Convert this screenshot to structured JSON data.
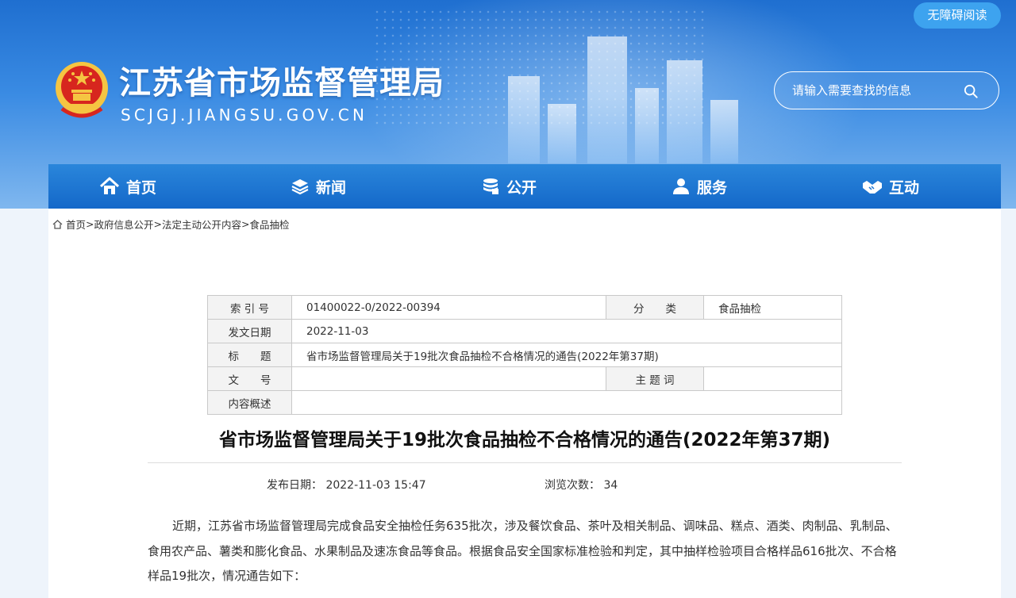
{
  "header": {
    "accessibility_label": "无障碍阅读",
    "site_title": "江苏省市场监督管理局",
    "site_domain": "SCJGJ.JIANGSU.GOV.CN",
    "search_placeholder": "请输入需要查找的信息"
  },
  "nav": {
    "items": [
      {
        "label": "首页",
        "icon": "home-icon"
      },
      {
        "label": "新闻",
        "icon": "layers-icon"
      },
      {
        "label": "公开",
        "icon": "database-icon"
      },
      {
        "label": "服务",
        "icon": "user-icon"
      },
      {
        "label": "互动",
        "icon": "handshake-icon"
      }
    ]
  },
  "breadcrumb": {
    "items": [
      "首页",
      "政府信息公开",
      "法定主动公开内容",
      "食品抽检"
    ],
    "separator": ">"
  },
  "meta_table": {
    "index_label": "索 引 号",
    "index_value": "01400022-0/2022-00394",
    "category_label": "分　　类",
    "category_value": "食品抽检",
    "date_label": "发文日期",
    "date_value": "2022-11-03",
    "title_label": "标　　题",
    "title_value": "省市场监督管理局关于19批次食品抽检不合格情况的通告(2022年第37期)",
    "docno_label": "文　　号",
    "docno_value": "",
    "keywords_label": "主 题 词",
    "keywords_value": "",
    "summary_label": "内容概述",
    "summary_value": ""
  },
  "article": {
    "title": "省市场监督管理局关于19批次食品抽检不合格情况的通告(2022年第37期)",
    "publish_label": "发布日期：",
    "publish_value": "2022-11-03 15:47",
    "views_label": "浏览次数：",
    "views_value": "34",
    "paragraph": "近期，江苏省市场监督管理局完成食品安全抽检任务635批次，涉及餐饮食品、茶叶及相关制品、调味品、糕点、酒类、肉制品、乳制品、食用农产品、薯类和膨化食品、水果制品及速冻食品等食品。根据食品安全国家标准检验和判定，其中抽样检验项目合格样品616批次、不合格样品19批次，情况通告如下："
  },
  "colors": {
    "header_blue": "#1f6fd0",
    "nav_blue": "#1468c9",
    "accessibility_button": "#3da3ef",
    "emblem_red": "#d7261e",
    "emblem_gold": "#f5c542"
  }
}
